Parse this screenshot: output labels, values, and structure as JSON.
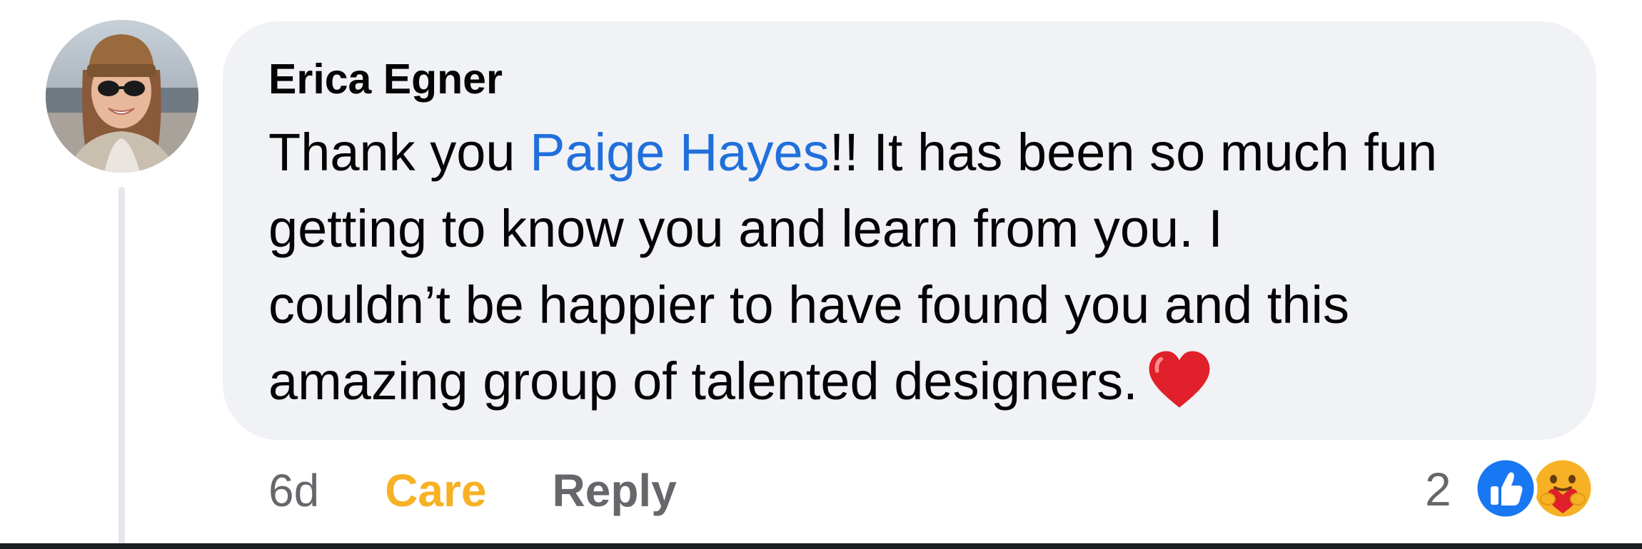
{
  "comment": {
    "author": "Erica Egner",
    "text_before_mention": "Thank you ",
    "mention": "Paige Hayes",
    "line1_rest": "!! It has been so much fun",
    "line2": "getting to know you and learn from you. I",
    "line3": "couldn’t be happier to have found you and this",
    "line4": "amazing group of talented designers.",
    "emoji_icon": "red-heart-icon"
  },
  "actions": {
    "timestamp": "6d",
    "care_label": "Care",
    "reply_label": "Reply"
  },
  "reactions": {
    "count": "2",
    "icons": [
      "like-icon",
      "care-icon"
    ]
  },
  "colors": {
    "bubble": "#f0f2f5",
    "mention": "#216fdb",
    "care": "#f7b125",
    "secondary_text": "#65676b",
    "like_blue": "#1877f2"
  }
}
